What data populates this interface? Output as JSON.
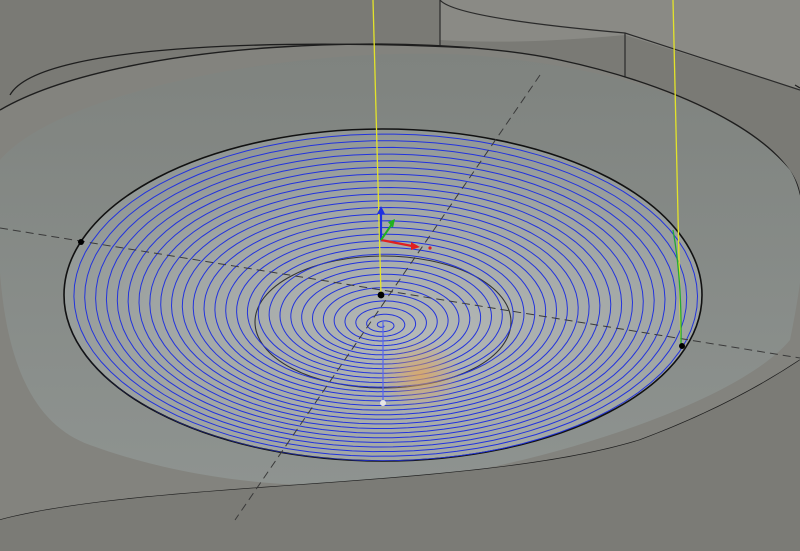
{
  "scene": {
    "type": "cam-spiral-toolpath-3d-viewport",
    "colors": {
      "background_stock": "#7a7a75",
      "pocket_floor": "#8f9491",
      "pocket_floor_light": "#a8adaa",
      "wall_face": "#83837e",
      "toolpath_spiral": "#2233dd",
      "retract_lines": "#e3e32a",
      "model_edges": "#1a1a1a",
      "sketch_axes_dashed": "#3a3a3a",
      "entry_marker": "#d9a25a",
      "triad_x": "#e02020",
      "triad_y": "#20b020",
      "triad_z": "#2030e0"
    },
    "icons": [
      "origin-triad-icon",
      "vertex-point-icon"
    ],
    "toolpath": {
      "pattern": "spiral",
      "visible_passes": 30
    }
  }
}
